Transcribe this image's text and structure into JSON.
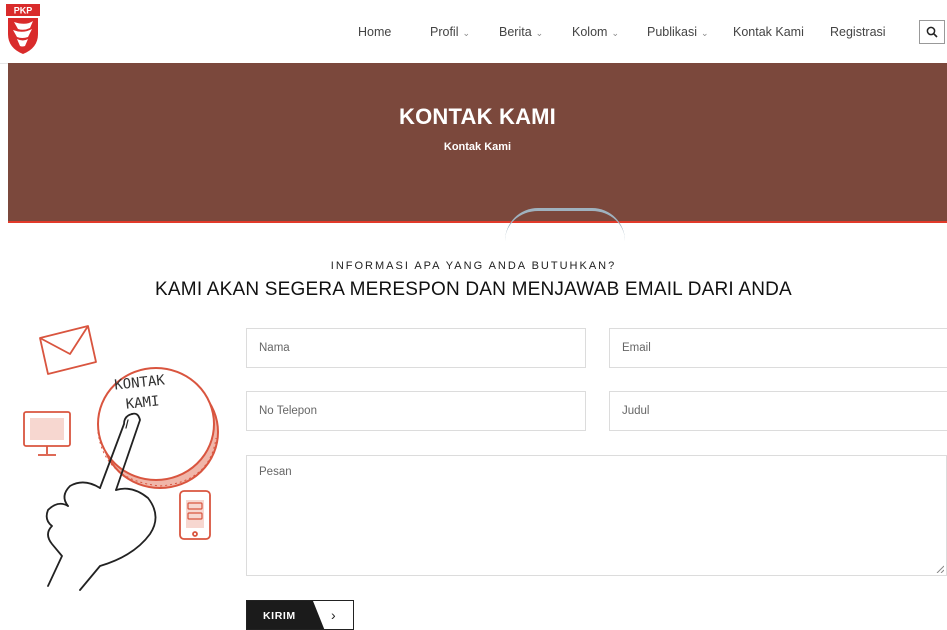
{
  "brand": {
    "logo_text": "PKP"
  },
  "nav": {
    "home": "Home",
    "profil": "Profil",
    "berita": "Berita",
    "kolom": "Kolom",
    "publikasi": "Publikasi",
    "kontak": "Kontak Kami",
    "registrasi": "Registrasi",
    "dropdown_icon": "chevron-down-icon",
    "search_icon": "search-icon"
  },
  "banner": {
    "title": "KONTAK KAMI",
    "breadcrumb": "Kontak Kami",
    "bg_color": "#7b483c",
    "accent_color": "#e23a2a"
  },
  "section": {
    "kicker": "INFORMASI APA YANG ANDA BUTUHKAN?",
    "headline": "KAMI AKAN SEGERA MERESPON DAN MENJAWAB EMAIL DARI ANDA"
  },
  "illustration": {
    "text_line1": "KONTAK",
    "text_line2": "KAMI"
  },
  "form": {
    "nama_placeholder": "Nama",
    "email_placeholder": "Email",
    "telepon_placeholder": "No Telepon",
    "judul_placeholder": "Judul",
    "pesan_placeholder": "Pesan",
    "submit_label": "KIRIM"
  }
}
